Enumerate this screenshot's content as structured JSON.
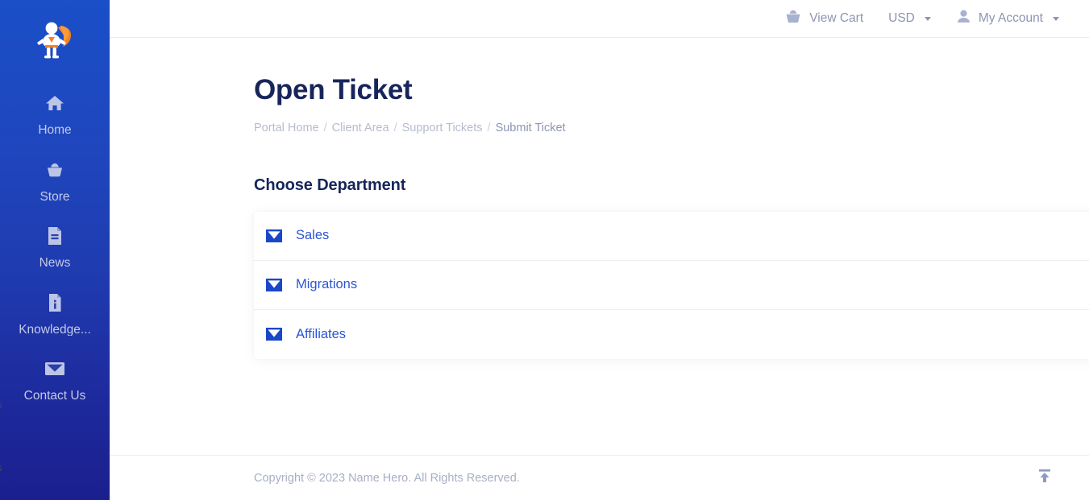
{
  "sidebar": {
    "logo_alt": "Name Hero superhero logo",
    "items": [
      {
        "label": "Home",
        "icon": "home-icon"
      },
      {
        "label": "Store",
        "icon": "basket-icon"
      },
      {
        "label": "News",
        "icon": "document-icon"
      },
      {
        "label": "Knowledge...",
        "icon": "knowledgebase-icon"
      },
      {
        "label": "Contact Us",
        "icon": "envelope-icon"
      }
    ],
    "edge_ghost_glyphs": [
      "s",
      "s"
    ]
  },
  "topbar": {
    "view_cart": "View Cart",
    "currency": "USD",
    "account": "My Account"
  },
  "main": {
    "page_title": "Open Ticket",
    "breadcrumb": {
      "items": [
        "Portal Home",
        "Client Area",
        "Support Tickets"
      ],
      "current": "Submit Ticket",
      "separator": "/"
    },
    "section_title": "Choose Department",
    "departments": [
      {
        "label": "Sales",
        "icon": "envelope-icon"
      },
      {
        "label": "Migrations",
        "icon": "envelope-icon"
      },
      {
        "label": "Affiliates",
        "icon": "envelope-icon"
      }
    ]
  },
  "footer": {
    "copyright": "Copyright © 2023 Name Hero. All Rights Reserved.",
    "to_top_icon": "arrow-to-top-icon"
  },
  "colors": {
    "sidebar_top": "#1a4fc8",
    "sidebar_bottom": "#1b1f8e",
    "accent_blue": "#2b55d4",
    "heading_navy": "#18255b",
    "muted_text": "#8d95b0",
    "brand_orange": "#f58220"
  }
}
